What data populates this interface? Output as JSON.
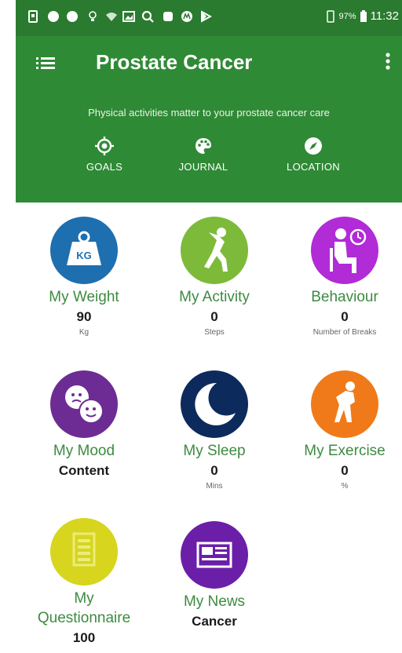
{
  "status_bar": {
    "battery_percent": "97%",
    "time": "11:32"
  },
  "header": {
    "title": "Prostate Cancer",
    "tagline": "Physical activities matter to your prostate cancer care",
    "tabs": [
      {
        "label": "GOALS",
        "icon": "target-icon"
      },
      {
        "label": "JOURNAL",
        "icon": "palette-icon"
      },
      {
        "label": "LOCATION",
        "icon": "compass-icon"
      }
    ]
  },
  "grid": {
    "weight": {
      "label": "My Weight",
      "value": "90",
      "unit": "Kg",
      "icon_text": "KG",
      "color": "#1d6fb0",
      "icon": "weight-icon"
    },
    "activity": {
      "label": "My Activity",
      "value": "0",
      "unit": "Steps",
      "color": "#7dba3a",
      "icon": "running-person-icon"
    },
    "behaviour": {
      "label": "Behaviour",
      "value": "0",
      "unit": "Number of Breaks",
      "color": "#b12bd6",
      "icon": "seated-person-clock-icon"
    },
    "mood": {
      "label": "My Mood",
      "value": "Content",
      "unit": "",
      "color": "#6d2c94",
      "icon": "faces-icon"
    },
    "sleep": {
      "label": "My Sleep",
      "value": "0",
      "unit": "Mins",
      "color": "#0c2a5c",
      "icon": "moon-icon"
    },
    "exercise": {
      "label": "My Exercise",
      "value": "0",
      "unit": "%",
      "color": "#f07a19",
      "icon": "exercise-person-icon"
    },
    "questionnaire": {
      "label_line1": "My",
      "label_line2": "Questionnaire",
      "value": "100",
      "color": "#d7d51e",
      "icon": "document-icon"
    },
    "news": {
      "label": "My News",
      "value": "Cancer",
      "color": "#6b1fa8",
      "icon": "newspaper-icon"
    }
  },
  "colors": {
    "status_bar": "#2a7a2f",
    "app_bar": "#2f8a35",
    "label_green": "#3d8b40"
  }
}
